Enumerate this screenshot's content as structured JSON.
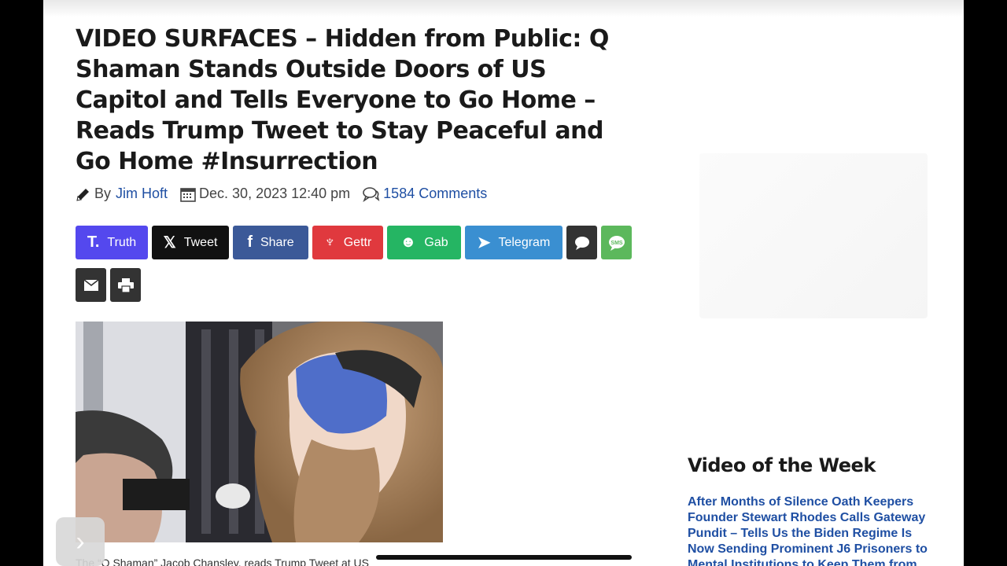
{
  "article": {
    "title": "VIDEO SURFACES – Hidden from Public: Q Shaman Stands Outside Doors of US Capitol and Tells Everyone to Go Home – Reads Trump Tweet to Stay Peaceful and Go Home #Insurrection",
    "by_label": "By",
    "author": "Jim Hoft",
    "date": "Dec. 30, 2023 12:40 pm",
    "comments": "1584 Comments",
    "image_caption": "The “Q Shaman” Jacob Chansley, reads Trump Tweet at US"
  },
  "share": {
    "buttons": [
      {
        "label": "Truth",
        "icon": "truth-social-icon",
        "color": "#5448ee"
      },
      {
        "label": "Tweet",
        "icon": "x-icon",
        "color": "#111111"
      },
      {
        "label": "Share",
        "icon": "facebook-icon",
        "color": "#3b5998"
      },
      {
        "label": "Gettr",
        "icon": "gettr-icon",
        "color": "#e0393e"
      },
      {
        "label": "Gab",
        "icon": "gab-frog-icon",
        "color": "#25b563"
      },
      {
        "label": "Telegram",
        "icon": "telegram-icon",
        "color": "#3a8fd1"
      }
    ],
    "icon_buttons": [
      {
        "icon": "comment-icon",
        "color": "#333333"
      },
      {
        "icon": "sms-icon",
        "color": "#5cb85c"
      },
      {
        "icon": "email-icon",
        "color": "#333333"
      },
      {
        "icon": "print-icon",
        "color": "#333333"
      }
    ]
  },
  "sidebar": {
    "video_of_week_title": "Video of the Week",
    "video_of_week_link": "After Months of Silence Oath Keepers Founder Stewart Rhodes Calls Gateway Pundit – Tells Us the Biden Regime Is Now Sending Prominent J6 Prisoners to Mental Institutions to Keep Them from"
  }
}
